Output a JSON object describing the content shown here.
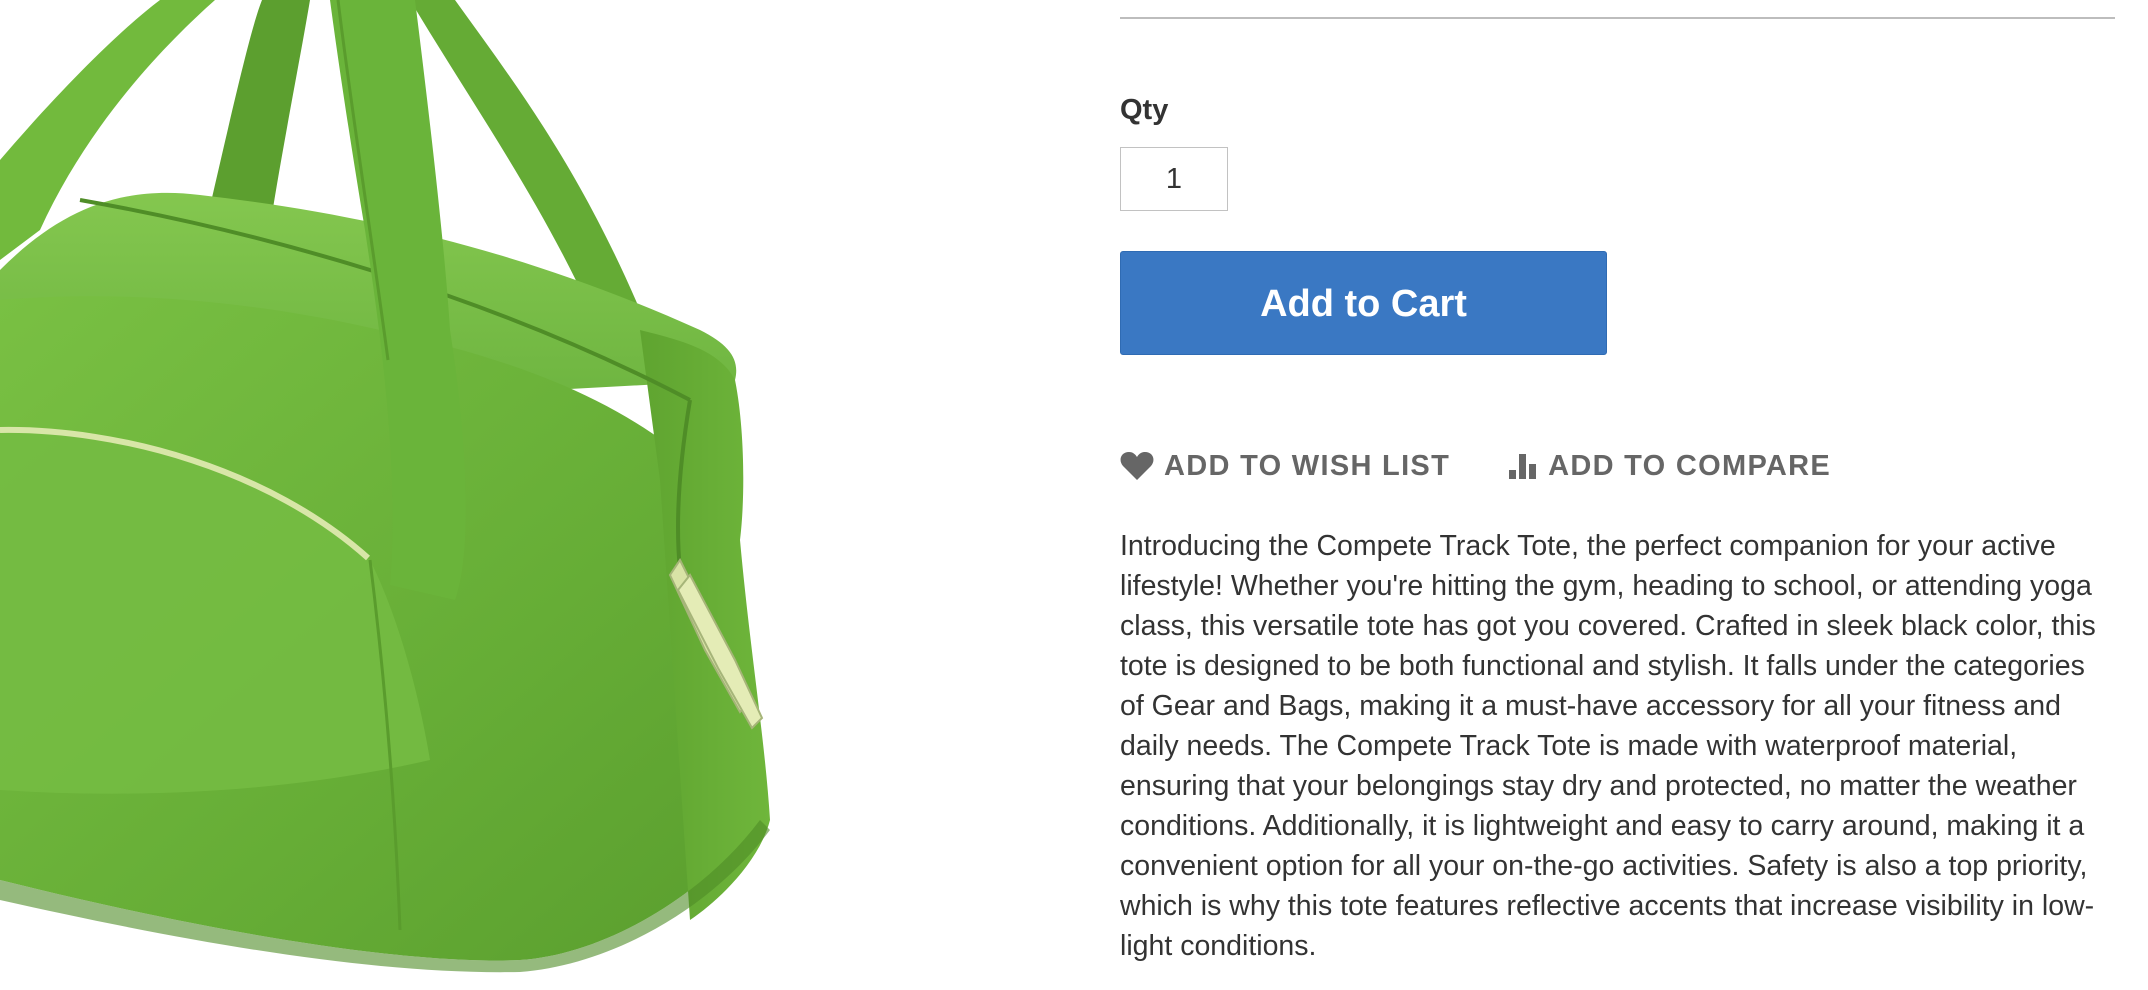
{
  "product": {
    "image_alt": "Compete Track Tote",
    "qty_label": "Qty",
    "qty_value": "1",
    "add_to_cart_label": "Add to Cart",
    "wishlist_label": "ADD TO WISH LIST",
    "compare_label": "ADD TO COMPARE",
    "description": "Introducing the Compete Track Tote, the perfect companion for your active lifestyle! Whether you're hitting the gym, heading to school, or attending yoga class, this versatile tote has got you covered. Crafted in sleek black color, this tote is designed to be both functional and stylish. It falls under the categories of Gear and Bags, making it a must-have accessory for all your fitness and daily needs. The Compete Track Tote is made with waterproof material, ensuring that your belongings stay dry and protected, no matter the weather conditions. Additionally, it is lightweight and easy to carry around, making it a convenient option for all your on-the-go activities. Safety is also a top priority, which is why this tote features reflective accents that increase visibility in low-light conditions."
  },
  "icons": {
    "wishlist": "heart-icon",
    "compare": "bar-chart-icon"
  },
  "colors": {
    "primary_button": "#3a78c3",
    "bag_green": "#6cb33f",
    "link_gray": "#666666",
    "text": "#333333"
  }
}
